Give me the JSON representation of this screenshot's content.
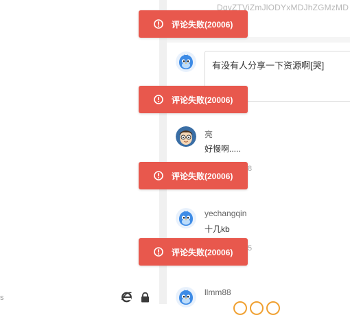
{
  "header": {
    "truncated_id": "DqyZTViZmJlODYxMDJhZGMzMD"
  },
  "comment_input": {
    "value": "有没有人分享一下资源啊[哭]"
  },
  "comments": [
    {
      "user": "亮",
      "text": "好慢啊.....",
      "meta_partial": "8"
    },
    {
      "user": "yechangqin",
      "text": "十几kb",
      "meta_partial": "5"
    },
    {
      "user": "llmm88"
    }
  ],
  "toasts": [
    {
      "label": "评论失败(20006)"
    },
    {
      "label": "评论失败(20006)"
    },
    {
      "label": "评论失败(20006)"
    },
    {
      "label": "评论失败(20006)"
    }
  ],
  "left_pane": {
    "edge_char": "s"
  },
  "icons": {
    "toast": "alert-circle-icon",
    "browser": "ie-browser-icon",
    "security": "lock-icon",
    "avatar_default": "blue-bird-avatar-icon",
    "avatar_user": "cartoon-boy-avatar-icon"
  },
  "colors": {
    "toast_bg": "#e8584d",
    "toast_text": "#ffffff",
    "avatar_blue": "#3d8be6"
  }
}
